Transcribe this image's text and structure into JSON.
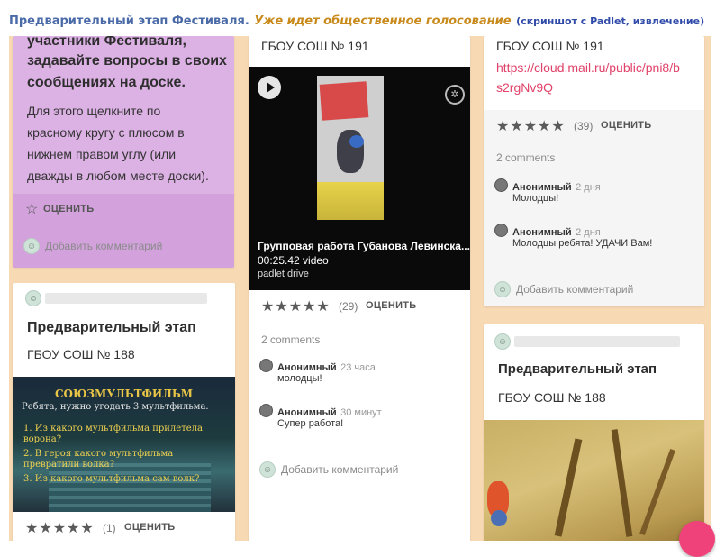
{
  "header": {
    "part1": "Предварительный этап Фестиваля.",
    "part2": "Уже идет общественное голосование",
    "part3": "(скриншот с  Padlet, извлечение)"
  },
  "col1": {
    "purple_card": {
      "text_big": [
        "участники Фестиваля,",
        "задавайте вопросы в своих",
        "сообщениях на доске."
      ],
      "text_small": [
        "Для этого щелкните  по",
        "красному кругу с плюсом в",
        "нижнем правом углу (или",
        "дважды в любом месте доски)."
      ],
      "rate_label": "ОЦЕНИТЬ",
      "add_comment": "Добавить комментарий"
    },
    "card2": {
      "title": "Предварительный этап",
      "school": "ГБОУ СОШ № 188",
      "image_text": {
        "brand": "СОЮЗМУЛЬТФИЛЬМ",
        "subtitle": "Ребята, нужно угодать 3 мультфильма.",
        "q1": "1. Из какого мультфильма прилетела ворона?",
        "q2": "2. В героя какого мультфильма превратили волка?",
        "q3": "3. Из какого мультфильма сам волк?"
      },
      "stars": "★★★★★",
      "count": "(1)",
      "rate_label": "ОЦЕНИТЬ"
    }
  },
  "col2": {
    "card": {
      "school": "ГБОУ СОШ № 191",
      "video": {
        "title": "Групповая работа Губанова Левинска...",
        "duration": "00:25.42 video",
        "source": "padlet drive"
      },
      "stars": "★★★★★",
      "count": "(29)",
      "rate_label": "ОЦЕНИТЬ",
      "comments_count": "2 comments",
      "comments": [
        {
          "name": "Анонимный",
          "time": "23 часа",
          "text": "молодцы!"
        },
        {
          "name": "Анонимный",
          "time": "30 минут",
          "text": "Супер работа!"
        }
      ],
      "add_comment": "Добавить комментарий"
    }
  },
  "col3": {
    "card1": {
      "school": "ГБОУ СОШ № 191",
      "link_line1": "https://cloud.mail.ru/public/pni8/b",
      "link_line2": "s2rgNv9Q",
      "stars": "★★★★★",
      "count": "(39)",
      "rate_label": "ОЦЕНИТЬ",
      "comments_count": "2 comments",
      "comments": [
        {
          "name": "Анонимный",
          "time": "2 дня",
          "text": "Молодцы!"
        },
        {
          "name": "Анонимный",
          "time": "2 дня",
          "text": "Молодцы ребята! УДАЧИ Вам!"
        }
      ],
      "add_comment": "Добавить комментарий"
    },
    "card2": {
      "title": "Предварительный этап",
      "school": "ГБОУ СОШ № 188"
    }
  },
  "colors": {
    "board": "#f7d9b3",
    "purple": "#dcb1e4",
    "link": "#e0436a",
    "fab": "#f0427a"
  }
}
